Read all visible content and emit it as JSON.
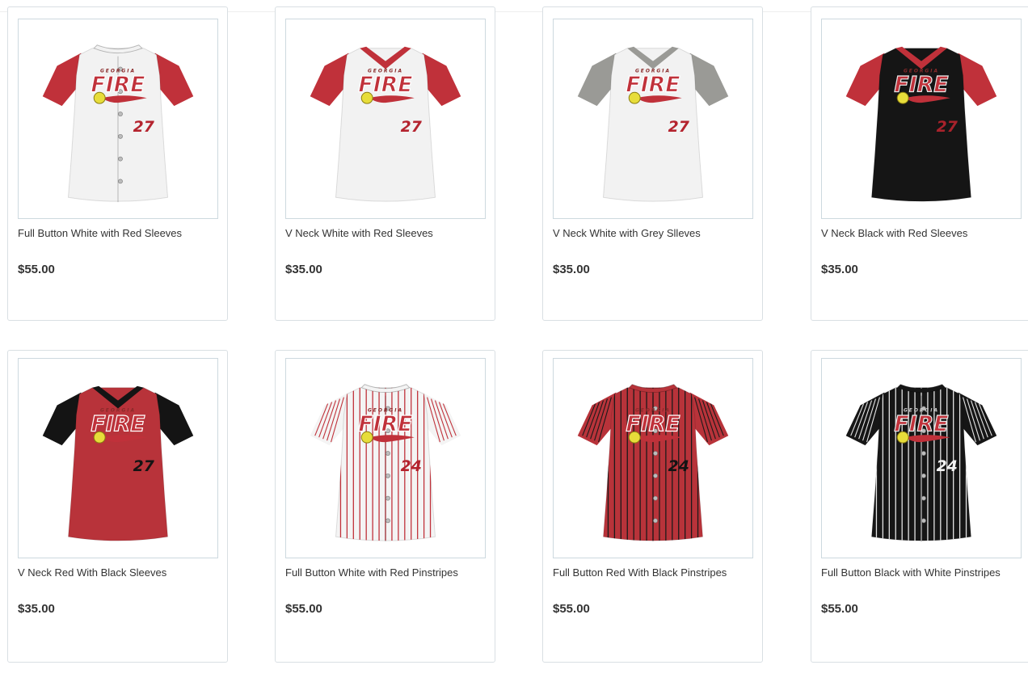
{
  "products": [
    {
      "name": "Full Button White with Red Sleeves",
      "price": "$55.00",
      "style": "button",
      "body_color": "#f2f2f2",
      "sleeve_color": "#c0313a",
      "collar_color": "#f2f2f2",
      "pinstripe_color": "",
      "logo_text": "FIRE",
      "logo_subtext": "GEORGIA",
      "number": "27",
      "number_color": "#b4232e"
    },
    {
      "name": "V Neck White with Red Sleeves",
      "price": "$35.00",
      "style": "vneck",
      "body_color": "#f2f2f2",
      "sleeve_color": "#c0313a",
      "collar_color": "#c0313a",
      "pinstripe_color": "",
      "logo_text": "FIRE",
      "logo_subtext": "GEORGIA",
      "number": "27",
      "number_color": "#b4232e"
    },
    {
      "name": "V Neck White with Grey Slleves",
      "price": "$35.00",
      "style": "vneck",
      "body_color": "#f2f2f2",
      "sleeve_color": "#9a9a96",
      "collar_color": "#9a9a96",
      "pinstripe_color": "",
      "logo_text": "FIRE",
      "logo_subtext": "GEORGIA",
      "number": "27",
      "number_color": "#b4232e"
    },
    {
      "name": "V Neck Black with Red Sleeves",
      "price": "$35.00",
      "style": "vneck",
      "body_color": "#151515",
      "sleeve_color": "#c0313a",
      "collar_color": "#c0313a",
      "pinstripe_color": "",
      "logo_text": "FIRE",
      "logo_subtext": "GEORGIA",
      "number": "27",
      "number_color": "#a8222b"
    },
    {
      "name": "V Neck Red With Black Sleeves",
      "price": "$35.00",
      "style": "vneck",
      "body_color": "#b8333a",
      "sleeve_color": "#141414",
      "collar_color": "#141414",
      "pinstripe_color": "",
      "logo_text": "FIRE",
      "logo_subtext": "GEORGIA",
      "number": "27",
      "number_color": "#141414"
    },
    {
      "name": "Full Button White with Red Pinstripes",
      "price": "$55.00",
      "style": "button",
      "body_color": "#f4f4f4",
      "sleeve_color": "#f4f4f4",
      "collar_color": "#f4f4f4",
      "pinstripe_color": "#c0313a",
      "logo_text": "FIRE",
      "logo_subtext": "GEORGIA",
      "number": "24",
      "number_color": "#b4232e"
    },
    {
      "name": "Full Button Red With Black Pinstripes",
      "price": "$55.00",
      "style": "button",
      "body_color": "#b8333a",
      "sleeve_color": "#b8333a",
      "collar_color": "#b8333a",
      "pinstripe_color": "#1a1a1a",
      "logo_text": "FIRE",
      "logo_subtext": "GEORGIA",
      "number": "24",
      "number_color": "#141414"
    },
    {
      "name": "Full Button Black with White Pinstripes",
      "price": "$55.00",
      "style": "button",
      "body_color": "#161616",
      "sleeve_color": "#161616",
      "collar_color": "#161616",
      "pinstripe_color": "#e6e6e6",
      "logo_text": "FIRE",
      "logo_subtext": "GEORGIA",
      "number": "24",
      "number_color": "#f2f2f2"
    }
  ]
}
